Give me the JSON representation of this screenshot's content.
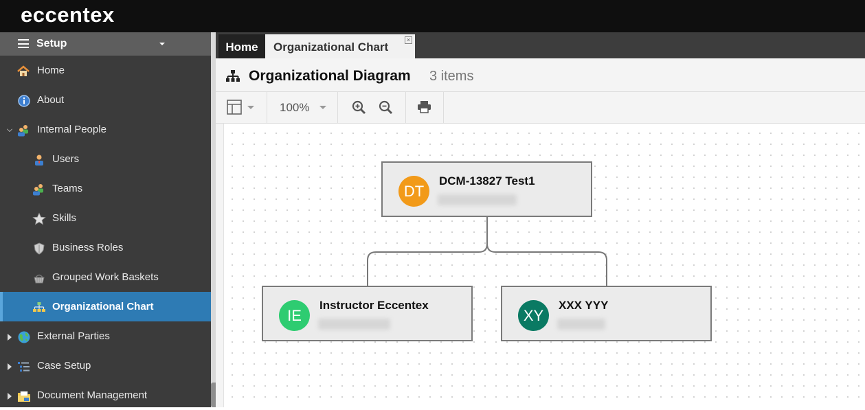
{
  "app": {
    "logo": "eccentex"
  },
  "sidebar": {
    "header": "Setup",
    "items": [
      {
        "label": "Home"
      },
      {
        "label": "About"
      },
      {
        "label": "Internal People"
      },
      {
        "label": "Users"
      },
      {
        "label": "Teams"
      },
      {
        "label": "Skills"
      },
      {
        "label": "Business Roles"
      },
      {
        "label": "Grouped Work Baskets"
      },
      {
        "label": "Organizational Chart"
      },
      {
        "label": "External Parties"
      },
      {
        "label": "Case Setup"
      },
      {
        "label": "Document Management"
      }
    ]
  },
  "tabs": [
    {
      "label": "Home"
    },
    {
      "label": "Organizational Chart",
      "close": "×"
    }
  ],
  "page": {
    "title": "Organizational Diagram",
    "count": "3 items"
  },
  "toolbar": {
    "zoom": "100%"
  },
  "diagram": {
    "nodes": [
      {
        "initials": "DT",
        "name": "DCM-13827 Test1",
        "color": "#f29a19"
      },
      {
        "initials": "IE",
        "name": "Instructor Eccentex",
        "color": "#2ecc71"
      },
      {
        "initials": "XY",
        "name": "XXX YYY",
        "color": "#0a7a63"
      }
    ]
  },
  "colors": {
    "active_nav": "#2e7bb4",
    "topbar": "#0f0f0f",
    "sidebar": "#3b3b3b"
  }
}
